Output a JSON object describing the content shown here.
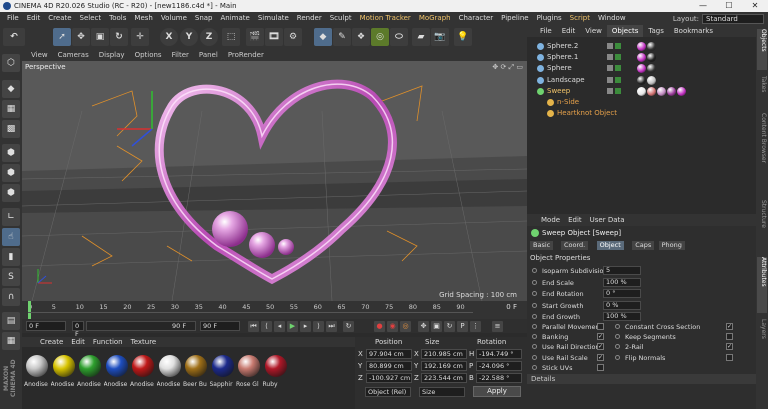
{
  "window": {
    "title": "CINEMA 4D R20.026 Studio (RC - R20) - [new1186.c4d *] - Main"
  },
  "menubar": {
    "items": [
      "File",
      "Edit",
      "Create",
      "Select",
      "Tools",
      "Mesh",
      "Volume",
      "Snap",
      "Animate",
      "Simulate",
      "Render",
      "Sculpt",
      "Motion Tracker",
      "MoGraph",
      "Character",
      "Pipeline",
      "Plugins",
      "Script",
      "Window"
    ],
    "layout_label": "Layout:",
    "layout_value": "Standard"
  },
  "toolbar": {
    "xyz": [
      "X",
      "Y",
      "Z"
    ]
  },
  "viewport": {
    "menu": [
      "View",
      "Cameras",
      "Display",
      "Options",
      "Filter",
      "Panel",
      "ProRender"
    ],
    "label": "Perspective",
    "grid_spacing": "Grid Spacing : 100 cm"
  },
  "timeline": {
    "ticks": [
      "0",
      "5",
      "10",
      "15",
      "20",
      "25",
      "30",
      "35",
      "40",
      "45",
      "50",
      "55",
      "60",
      "65",
      "70",
      "75",
      "80",
      "85",
      "90"
    ],
    "end_label": "0 F"
  },
  "transport": {
    "current_frame": "0 F",
    "min_frame": "0 F",
    "max_frame": "90 F",
    "end_frame": "90 F"
  },
  "material_manager": {
    "menu": [
      "Create",
      "Edit",
      "Function",
      "Texture"
    ],
    "materials": [
      {
        "name": "Anodise",
        "color": "#c8c8c8"
      },
      {
        "name": "Anodise",
        "color": "#d8c400"
      },
      {
        "name": "Anodise",
        "color": "#2ea02e"
      },
      {
        "name": "Anodise",
        "color": "#1e4ec0"
      },
      {
        "name": "Anodise",
        "color": "#c01818"
      },
      {
        "name": "Anodise",
        "color": "#e0e0e0"
      },
      {
        "name": "Beer Bu",
        "color": "#a07018"
      },
      {
        "name": "Sapphir",
        "color": "#1c2a8c"
      },
      {
        "name": "Rose Gl",
        "color": "#c87a70"
      },
      {
        "name": "Ruby",
        "color": "#b01828"
      }
    ]
  },
  "coordinates": {
    "headers": [
      "Position",
      "Size",
      "Rotation"
    ],
    "rows": [
      {
        "axis": "X",
        "pos": "97.904 cm",
        "size_axis": "X",
        "size": "210.985 cm",
        "rot_axis": "H",
        "rot": "-194.749 °"
      },
      {
        "axis": "Y",
        "pos": "80.899 cm",
        "size_axis": "Y",
        "size": "192.169 cm",
        "rot_axis": "P",
        "rot": "-24.096 °"
      },
      {
        "axis": "Z",
        "pos": "-100.927 cm",
        "size_axis": "Z",
        "size": "223.544 cm",
        "rot_axis": "B",
        "rot": "-22.588 °"
      }
    ],
    "mode": "Object (Rel)",
    "size_mode": "Size",
    "apply_label": "Apply"
  },
  "object_manager": {
    "menu": [
      "File",
      "Edit",
      "View",
      "Objects",
      "Tags",
      "Bookmarks"
    ],
    "objects": [
      {
        "name": "Sphere.2",
        "color": "#7fb3e0",
        "selected": false,
        "child": false
      },
      {
        "name": "Sphere.1",
        "color": "#7fb3e0",
        "selected": false,
        "child": false
      },
      {
        "name": "Sphere",
        "color": "#7fb3e0",
        "selected": false,
        "child": false
      },
      {
        "name": "Landscape",
        "color": "#7fb3e0",
        "selected": false,
        "child": false
      },
      {
        "name": "Sweep",
        "color": "#6fd26f",
        "selected": true,
        "child": false
      },
      {
        "name": "n-Side",
        "color": "#e5b44a",
        "selected": true,
        "child": true
      },
      {
        "name": "Heartknot Object",
        "color": "#e5b44a",
        "selected": true,
        "child": true
      }
    ]
  },
  "right_tabs": [
    "Objects",
    "Takes",
    "Content Browser",
    "Structure",
    "Attributes",
    "Layers"
  ],
  "attributes": {
    "menu": [
      "Mode",
      "Edit",
      "User Data"
    ],
    "object_title": "Sweep Object [Sweep]",
    "tabs": [
      "Basic",
      "Coord.",
      "Object",
      "Caps",
      "Phong"
    ],
    "active_tab": "Object",
    "section": "Object Properties",
    "fields": [
      {
        "label": "Isoparm Subdivision",
        "value": "5"
      },
      {
        "label": "End Scale",
        "value": "100 %"
      },
      {
        "label": "End Rotation",
        "value": "0 °"
      },
      {
        "label": "Start Growth",
        "value": "0 %"
      },
      {
        "label": "End Growth",
        "value": "100 %"
      }
    ],
    "checks_left": [
      {
        "label": "Parallel Movement",
        "checked": false
      },
      {
        "label": "Banking",
        "checked": true
      },
      {
        "label": "Use Rail Direction",
        "checked": true
      },
      {
        "label": "Use Rail Scale",
        "checked": true
      },
      {
        "label": "Stick UVs",
        "checked": false
      }
    ],
    "checks_right": [
      {
        "label": "Constant Cross Section",
        "checked": true
      },
      {
        "label": "Keep Segments",
        "checked": false
      },
      {
        "label": "2-Rail",
        "checked": true
      },
      {
        "label": "Flip Normals",
        "checked": false
      }
    ],
    "details": "Details"
  },
  "maxon_label": "MAXON CINEMA 4D",
  "colors": {
    "accent": "#5a7fa6",
    "heart": "#c86cc8",
    "spline": "#e0902a"
  }
}
